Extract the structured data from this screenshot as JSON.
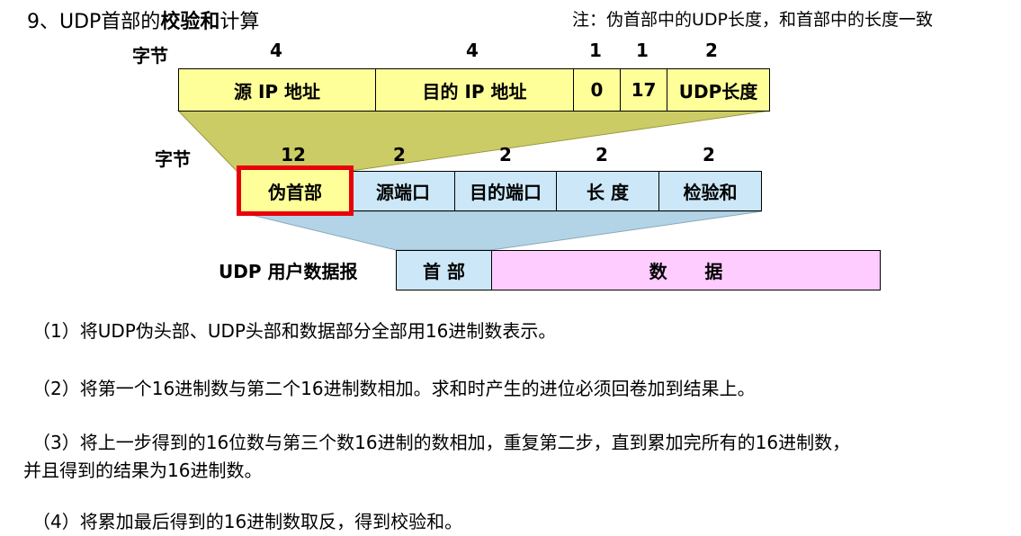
{
  "title": {
    "prefix": "9、UDP首部的",
    "bold": "校验和",
    "suffix": "计算"
  },
  "note": "注：伪首部中的UDP长度，和首部中的长度一致",
  "pseudo_header": {
    "bytes_label": "字节",
    "byte_counts": [
      "4",
      "4",
      "1",
      "1",
      "2"
    ],
    "fields": [
      "源 IP 地址",
      "目的 IP 地址",
      "0",
      "17",
      "UDP长度"
    ]
  },
  "udp_header": {
    "bytes_label": "字节",
    "byte_counts": [
      "12",
      "2",
      "2",
      "2",
      "2"
    ],
    "fields": [
      "伪首部",
      "源端口",
      "目的端口",
      "长  度",
      "检验和"
    ]
  },
  "datagram": {
    "label": "UDP 用户数据报",
    "header": "首  部",
    "data": "数      据"
  },
  "steps": [
    "（1）将UDP伪头部、UDP头部和数据部分全部用16进制数表示。",
    "（2）将第一个16进制数与第二个16进制数相加。求和时产生的进位必须回卷加到结果上。",
    "（3）将上一步得到的16位数与第三个数16进制的数相加，重复第二步，直到累加完所有的16进制数，",
    "并且得到的结果为16进制数。",
    "（4）将累加最后得到的16进制数取反，得到校验和。"
  ],
  "colors": {
    "yellow": "#ffff99",
    "blue": "#cce8f8",
    "pink": "#ffccff",
    "highlight": "#e8000b"
  }
}
